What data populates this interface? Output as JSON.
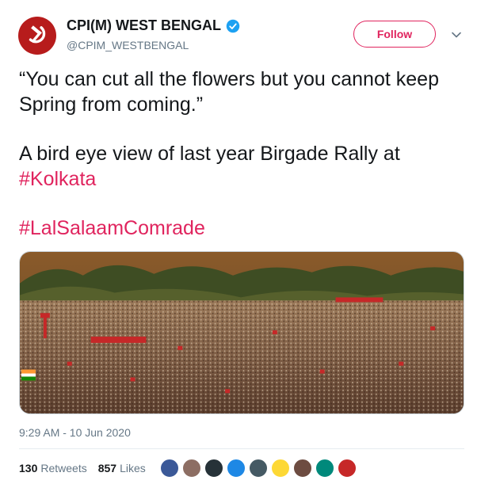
{
  "account": {
    "display_name": "CPI(M) WEST BENGAL",
    "handle": "@CPIM_WESTBENGAL",
    "verified_icon": "verified-badge-icon",
    "avatar_icon": "hammer-sickle-icon"
  },
  "actions": {
    "follow_label": "Follow",
    "more_icon": "chevron-down-icon"
  },
  "tweet": {
    "quote": "“You can cut all the flowers but you cannot keep Spring from coming.”",
    "line2": "A bird eye view of last year Birgade Rally at",
    "hashtag1": "#Kolkata",
    "hashtag2": "#LalSalaamComrade",
    "timestamp": "9:29 AM - 10 Jun 2020"
  },
  "stats": {
    "retweets_count": "130",
    "retweets_label": "Retweets",
    "likes_count": "857",
    "likes_label": "Likes"
  },
  "likers": [
    {
      "color": "#3b5998"
    },
    {
      "color": "#8d6e63"
    },
    {
      "color": "#263238"
    },
    {
      "color": "#1e88e5"
    },
    {
      "color": "#455a64"
    },
    {
      "color": "#fdd835"
    },
    {
      "color": "#6d4c41"
    },
    {
      "color": "#00897b"
    },
    {
      "color": "#c62828"
    }
  ],
  "colors": {
    "brand_accent": "#e0245e",
    "secondary_text": "#657786",
    "verified_blue": "#1da1f2"
  }
}
